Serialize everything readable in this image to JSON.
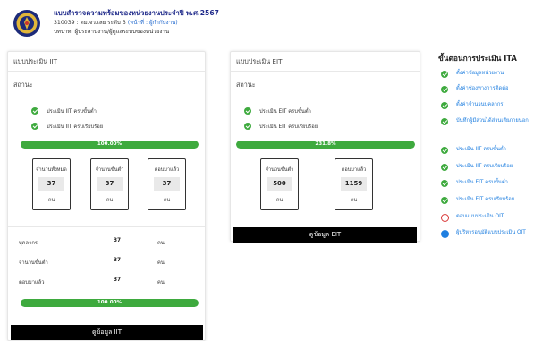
{
  "header": {
    "title": "แบบสำรวจความพร้อมของหน่วยงานประจำปี พ.ศ.2567",
    "org_line": "310039 : ตม.จว.เลย ระดับ 3",
    "role_label": "(หน้าที่ : ผู้กำกับงาน)",
    "user_line": "บทบาท: ผู้ประสานงาน/ผู้ดูแลระบบของหน่วยงาน"
  },
  "iit": {
    "title": "แบบประเมิน IIT",
    "status_label": "สถานะ",
    "checks": [
      "ประเมิน IIT ครบขั้นต่ำ",
      "ประเมิน IIT ครบเรียบร้อย"
    ],
    "progress_text": "100.00%",
    "progress_value": 100,
    "stats": [
      {
        "label": "จำนวนทั้งหมด",
        "value": "37",
        "unit": "คน"
      },
      {
        "label": "จำนวนขั้นต่ำ",
        "value": "37",
        "unit": "คน"
      },
      {
        "label": "ตอบมาแล้ว",
        "value": "37",
        "unit": "คน"
      }
    ],
    "summary": [
      {
        "label": "บุคลากร",
        "value": "37",
        "unit": "คน"
      },
      {
        "label": "จำนวนขั้นต่ำ",
        "value": "37",
        "unit": "คน"
      },
      {
        "label": "ตอบมาแล้ว",
        "value": "37",
        "unit": "คน"
      }
    ],
    "progress2_text": "100.00%",
    "progress2_value": 100,
    "button_label": "ดูข้อมูล IIT"
  },
  "eit": {
    "title": "แบบประเมิน EIT",
    "status_label": "สถานะ",
    "checks": [
      "ประเมิน EIT ครบขั้นต่ำ",
      "ประเมิน EIT ครบเรียบร้อย"
    ],
    "progress_text": "231.8%",
    "progress_value": 100,
    "stats": [
      {
        "label": "จำนวนขั้นต่ำ",
        "value": "500",
        "unit": "คน"
      },
      {
        "label": "ตอบมาแล้ว",
        "value": "1159",
        "unit": "คน"
      }
    ],
    "button_label": "ดูข้อมูล EIT"
  },
  "steps": {
    "title": "ขั้นตอนการประเมิน ITA",
    "items": [
      {
        "label": "ตั้งค่าข้อมูลหน่วยงาน",
        "status": "done"
      },
      {
        "label": "ตั้งค่าช่องทางการติดต่อ",
        "status": "done"
      },
      {
        "label": "ตั้งค่าจำนวนบุคลากร",
        "status": "done"
      },
      {
        "label": "บันทึกผู้มีส่วนได้ส่วนเสียภายนอก",
        "status": "done"
      },
      {
        "label": "ประเมิน IIT ครบขั้นต่ำ",
        "status": "done"
      },
      {
        "label": "ประเมิน IIT ครบเรียบร้อย",
        "status": "done"
      },
      {
        "label": "ประเมิน EIT ครบขั้นต่ำ",
        "status": "done"
      },
      {
        "label": "ประเมิน EIT ครบเรียบร้อย",
        "status": "done"
      },
      {
        "label": "ตอบแบบประเมิน OIT",
        "status": "warning"
      },
      {
        "label": "ผู้บริหารอนุมัติแบบประเมิน OIT",
        "status": "pending"
      }
    ]
  },
  "colors": {
    "accent_green": "#3eaa3e",
    "link_blue": "#1f7fe0",
    "title_navy": "#1f2a8a",
    "warning_red": "#d93636"
  }
}
